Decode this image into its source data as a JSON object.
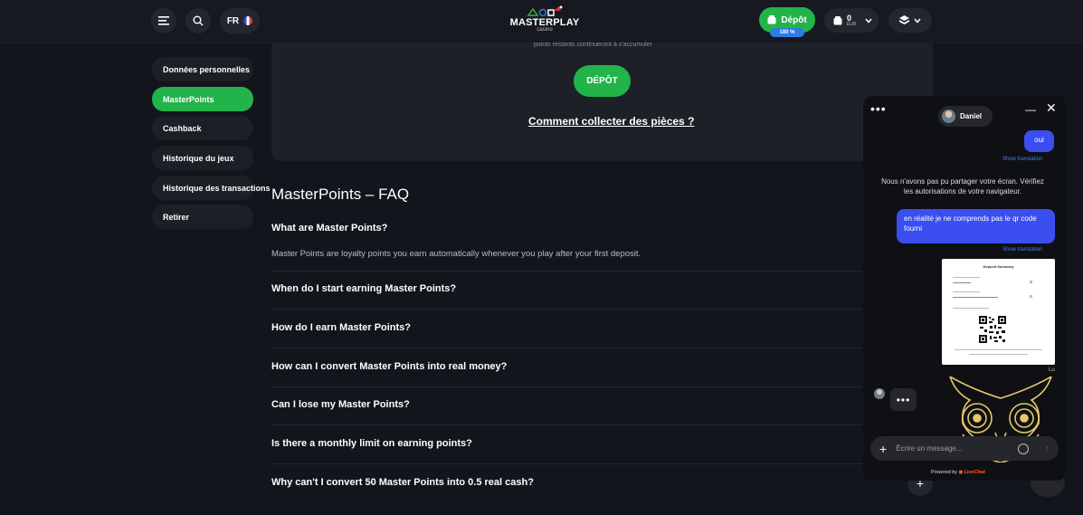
{
  "header": {
    "lang": "FR",
    "logo_text": "MASTERPLAY",
    "logo_sub": "casino",
    "deposit_label": "Dépôt",
    "bonus_tag": "180 %",
    "wallet_amount": "0",
    "wallet_currency": "EUR"
  },
  "sidebar": {
    "items": [
      {
        "label": "Données personnelles"
      },
      {
        "label": "MasterPoints"
      },
      {
        "label": "Cashback"
      },
      {
        "label": "Historique du jeux"
      },
      {
        "label": "Historique des transactions"
      },
      {
        "label": "Retirer"
      }
    ],
    "active_index": 1
  },
  "card": {
    "note": "points restants continueront à s'accumuler",
    "depot_label": "DÉPÔT",
    "collect_link": "Comment collecter des pièces ?"
  },
  "faq": {
    "title": "MasterPoints – FAQ",
    "items": [
      {
        "question": "What are Master Points?",
        "answer": "Master Points are loyalty points you earn automatically whenever you play after your first deposit."
      },
      {
        "question": "When do I start earning Master Points?"
      },
      {
        "question": "How do I earn Master Points?"
      },
      {
        "question": "How can I convert Master Points into real money?"
      },
      {
        "question": "Can I lose my Master Points?"
      },
      {
        "question": "Is there a monthly limit on earning points?"
      },
      {
        "question": "Why can't I convert 50 Master Points into 0.5 real cash?"
      }
    ]
  },
  "chat": {
    "agent_name": "Daniel",
    "messages": {
      "oui": "oui",
      "show_translation": "Show translation",
      "system": "Nous n'avons pas pu partager votre écran. Vérifiez les autorisations de votre navigateur.",
      "user_msg": "en réalité je ne comprends pas le qr code fourni",
      "doc_title": "Deposit Summary",
      "read_mark": "Lu"
    },
    "input_placeholder": "Écrire un message...",
    "powered_by": "Powered by",
    "powered_brand": "LiveChat"
  },
  "colors": {
    "accent_green": "#22b34a",
    "bubble_blue": "#3b4ef0",
    "background": "#13151c",
    "owl_gold": "#e6c76a"
  }
}
